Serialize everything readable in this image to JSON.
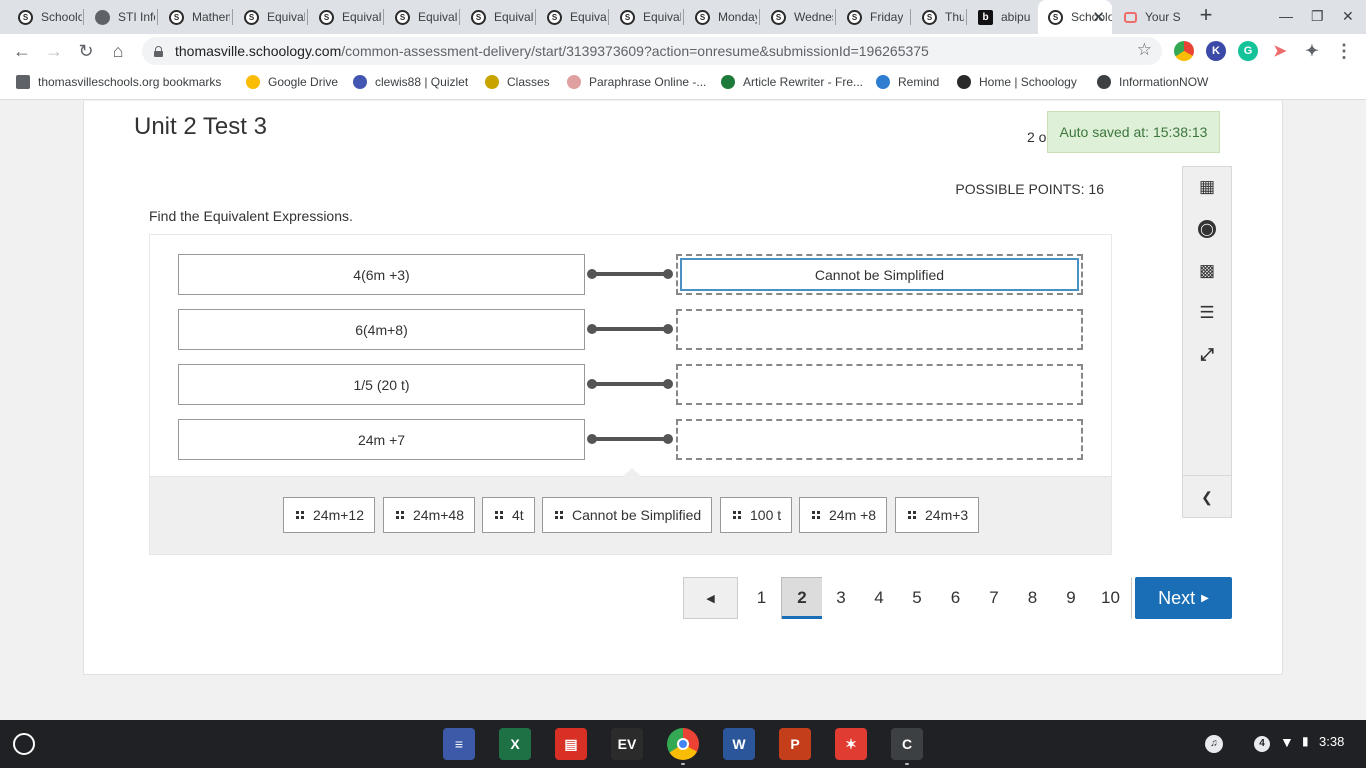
{
  "browser": {
    "tabs": [
      {
        "title": "Schoology",
        "icon": "schoology-icon"
      },
      {
        "title": "STI Information",
        "icon": "globe-icon"
      },
      {
        "title": "Mathematics",
        "icon": "schoology-icon"
      },
      {
        "title": "Equivalent",
        "icon": "schoology-icon"
      },
      {
        "title": "Equivalent",
        "icon": "schoology-icon"
      },
      {
        "title": "Equivalent",
        "icon": "schoology-icon"
      },
      {
        "title": "Equivalent",
        "icon": "schoology-icon"
      },
      {
        "title": "Equivalent",
        "icon": "schoology-icon"
      },
      {
        "title": "Equivalent",
        "icon": "schoology-icon"
      },
      {
        "title": "Monday",
        "icon": "schoology-icon"
      },
      {
        "title": "Wednesday",
        "icon": "schoology-icon"
      },
      {
        "title": "Friday",
        "icon": "schoology-icon"
      },
      {
        "title": "Thursday",
        "icon": "schoology-icon"
      },
      {
        "title": "abipu",
        "icon": "brainly-icon"
      },
      {
        "title": "Schoology",
        "icon": "schoology-icon"
      },
      {
        "title": "Your S",
        "icon": "remind-icon"
      }
    ],
    "active_tab_index": 14,
    "url_host": "thomasville.schoology.com",
    "url_path": "/common-assessment-delivery/start/3139373609?action=onresume&submissionId=196265375",
    "bookmarks": [
      {
        "label": "thomasvilleschools.org bookmarks",
        "icon": "folder-icon"
      },
      {
        "label": "Google Drive",
        "icon": "google-drive-icon"
      },
      {
        "label": "clewis88 | Quizlet",
        "icon": "quizlet-icon"
      },
      {
        "label": "Classes",
        "icon": "classes-icon"
      },
      {
        "label": "Paraphrase Online -...",
        "icon": "paraphrase-icon"
      },
      {
        "label": "Article Rewriter - Fre...",
        "icon": "article-rewriter-icon"
      },
      {
        "label": "Remind",
        "icon": "remind-icon"
      },
      {
        "label": "Home | Schoology",
        "icon": "schoology-icon"
      },
      {
        "label": "InformationNOW",
        "icon": "informationnow-icon"
      }
    ]
  },
  "assessment": {
    "title": "Unit 2 Test 3",
    "question_counter": "2 o",
    "autosave": "Auto saved at: 15:38:13",
    "possible_points": "POSSIBLE POINTS: 16",
    "prompt": "Find the Equivalent Expressions.",
    "matches": [
      {
        "expression": "4(6m +3)",
        "answer": "Cannot be Simplified"
      },
      {
        "expression": "6(4m+8)",
        "answer": ""
      },
      {
        "expression": "1/5 (20 t)",
        "answer": ""
      },
      {
        "expression": "24m +7",
        "answer": ""
      }
    ],
    "answer_bank": [
      "24m+12",
      "24m+48",
      "4t",
      "Cannot be Simplified",
      "100 t",
      "24m +8",
      "24m+3"
    ],
    "tools": [
      "calendar-grid-icon",
      "accessibility-icon",
      "calculator-icon",
      "notepad-icon",
      "fullscreen-icon",
      "collapse-chevron-icon"
    ]
  },
  "pagination": {
    "prev_symbol": "◀",
    "pages": [
      "1",
      "2",
      "3",
      "4",
      "5",
      "6",
      "7",
      "8",
      "9",
      "10"
    ],
    "current_page": "2",
    "next_label": "Next",
    "next_symbol": "▶"
  },
  "system": {
    "shelf_apps": [
      "google-docs-icon",
      "excel-icon",
      "pdf-editor-icon",
      "ev-icon",
      "chrome-icon",
      "word-icon",
      "powerpoint-icon",
      "acrobat-icon",
      "classroom-app-icon"
    ],
    "notification_count": "4",
    "clock": "3:38",
    "colors": {
      "accent": "#1a6eb5",
      "autosave_bg": "#dff0d8",
      "autosave_text": "#3c763d",
      "selected_border": "#4a90c2"
    }
  }
}
